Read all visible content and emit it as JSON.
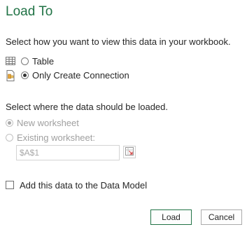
{
  "dialog": {
    "title": "Load To",
    "view_prompt": "Select how you want to view this data in your workbook.",
    "view_options": [
      {
        "label": "Table",
        "selected": false,
        "icon": "table-icon"
      },
      {
        "label": "Only Create Connection",
        "selected": true,
        "icon": "connection-icon"
      }
    ],
    "location_prompt": "Select where the data should be loaded.",
    "location_options": [
      {
        "label": "New worksheet",
        "selected": true,
        "enabled": false
      },
      {
        "label": "Existing worksheet:",
        "selected": false,
        "enabled": false
      }
    ],
    "cell_reference_value": "$A$1",
    "data_model_label": "Add this data to the Data Model",
    "data_model_checked": false,
    "load_label": "Load",
    "cancel_label": "Cancel",
    "accent_color": "#217346"
  }
}
